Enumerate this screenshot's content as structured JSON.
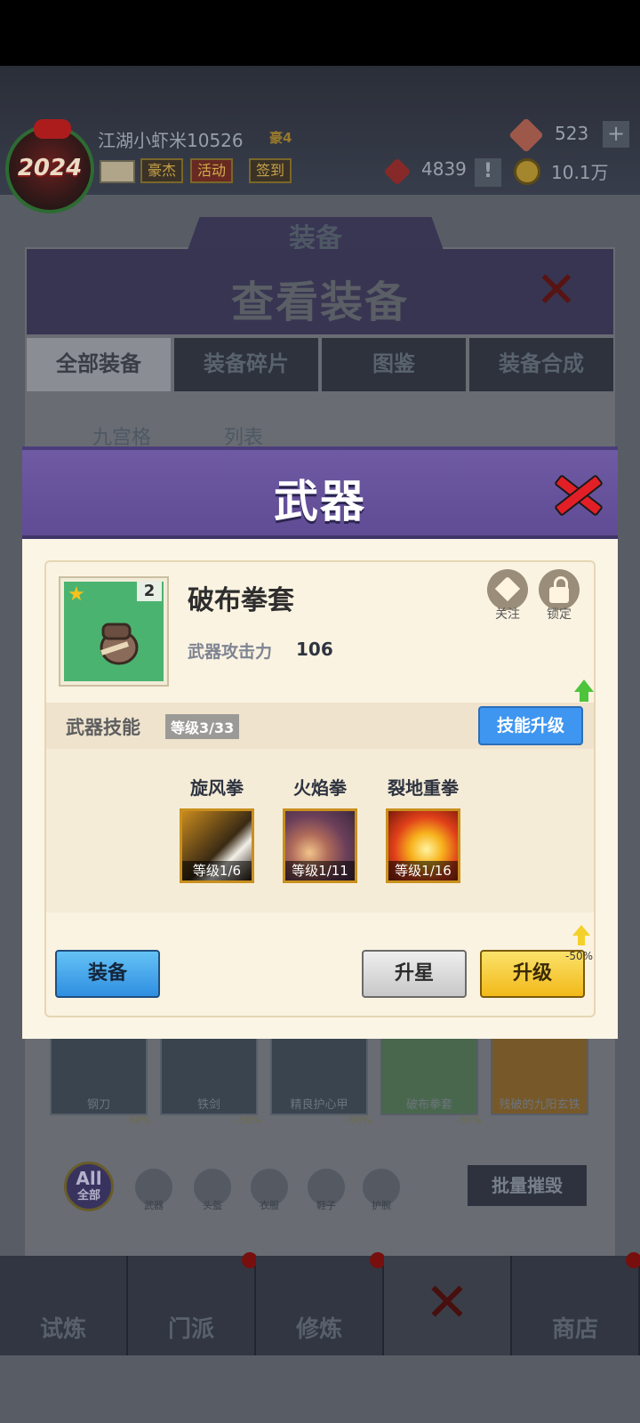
{
  "topbar": {
    "avatar_year": "2024",
    "player_name": "江湖小虾米10526",
    "rank": "豪4",
    "buttons": [
      "豪杰",
      "活动",
      "签到"
    ],
    "gems": "523",
    "plus": "+",
    "tokens": "4839",
    "alert": "!",
    "coins": "10.1万"
  },
  "background": {
    "tab_header": "装备",
    "title": "查看装备",
    "tabs": [
      "全部装备",
      "装备碎片",
      "图鉴",
      "装备合成"
    ],
    "views": [
      "九宫格",
      "列表"
    ],
    "items": [
      {
        "label": "钢刀",
        "pct": "-50%"
      },
      {
        "label": "铁剑",
        "pct": "-50%"
      },
      {
        "label": "精良护心甲",
        "pct": "-50%"
      },
      {
        "label": "破布拳套",
        "pct": "-50%"
      },
      {
        "label": "残破的九阳玄铁",
        "pct": ""
      }
    ],
    "filters": {
      "all_top": "All",
      "all_bottom": "全部",
      "others": [
        "武器",
        "头盔",
        "衣服",
        "鞋子",
        "护腕"
      ]
    },
    "bulk_destroy": "批量摧毁",
    "nav": [
      "试炼",
      "门派",
      "修炼",
      "",
      "商店"
    ]
  },
  "modal": {
    "title": "武器",
    "item": {
      "name": "破布拳套",
      "level": "2",
      "attack_label": "武器攻击力",
      "attack_value": "106"
    },
    "follow_label": "关注",
    "lock_label": "锁定",
    "skills_title": "武器技能",
    "skills_level": "等级3/33",
    "skill_upgrade": "技能升级",
    "skills": [
      {
        "name": "旋风拳",
        "level": "等级1/6"
      },
      {
        "name": "火焰拳",
        "level": "等级1/11"
      },
      {
        "name": "裂地重拳",
        "level": "等级1/16"
      }
    ],
    "equip": "装备",
    "star_up": "升星",
    "upgrade": "升级",
    "discount": "-50%"
  },
  "colors": {
    "header_purple": "#6f5aa4",
    "equip_blue": "#3f96f0",
    "upgrade_yellow": "#f2b91a",
    "item_green": "#4bb370"
  }
}
